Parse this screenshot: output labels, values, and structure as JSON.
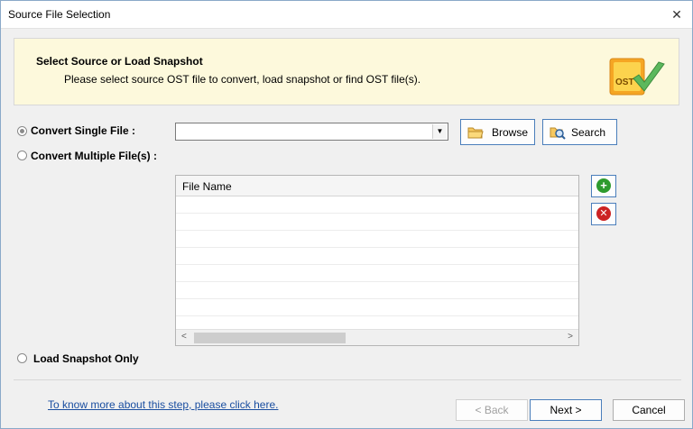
{
  "window": {
    "title": "Source File Selection"
  },
  "header": {
    "title": "Select Source or Load Snapshot",
    "subtitle": "Please select source OST file to convert, load snapshot or find OST file(s).",
    "logo_text": "OST"
  },
  "options": {
    "single": {
      "label": "Convert Single File :",
      "selected": true
    },
    "multiple": {
      "label": "Convert Multiple File(s) :",
      "selected": false
    },
    "snapshot": {
      "label": "Load Snapshot Only",
      "selected": false
    }
  },
  "file_combo": {
    "value": ""
  },
  "buttons": {
    "browse": "Browse",
    "search": "Search"
  },
  "file_list": {
    "column_header": "File Name",
    "rows": []
  },
  "side_buttons": {
    "add_icon": "plus-icon",
    "remove_icon": "remove-icon"
  },
  "footer": {
    "help_link": "To know more about this step, please click here.",
    "back": "< Back",
    "next": "Next >",
    "cancel": "Cancel"
  },
  "colors": {
    "header_bg": "#fdf9dc",
    "accent_border": "#4a7ebb",
    "link": "#1a4ea0",
    "add_green": "#2e9b2e",
    "remove_red": "#cc2222"
  }
}
